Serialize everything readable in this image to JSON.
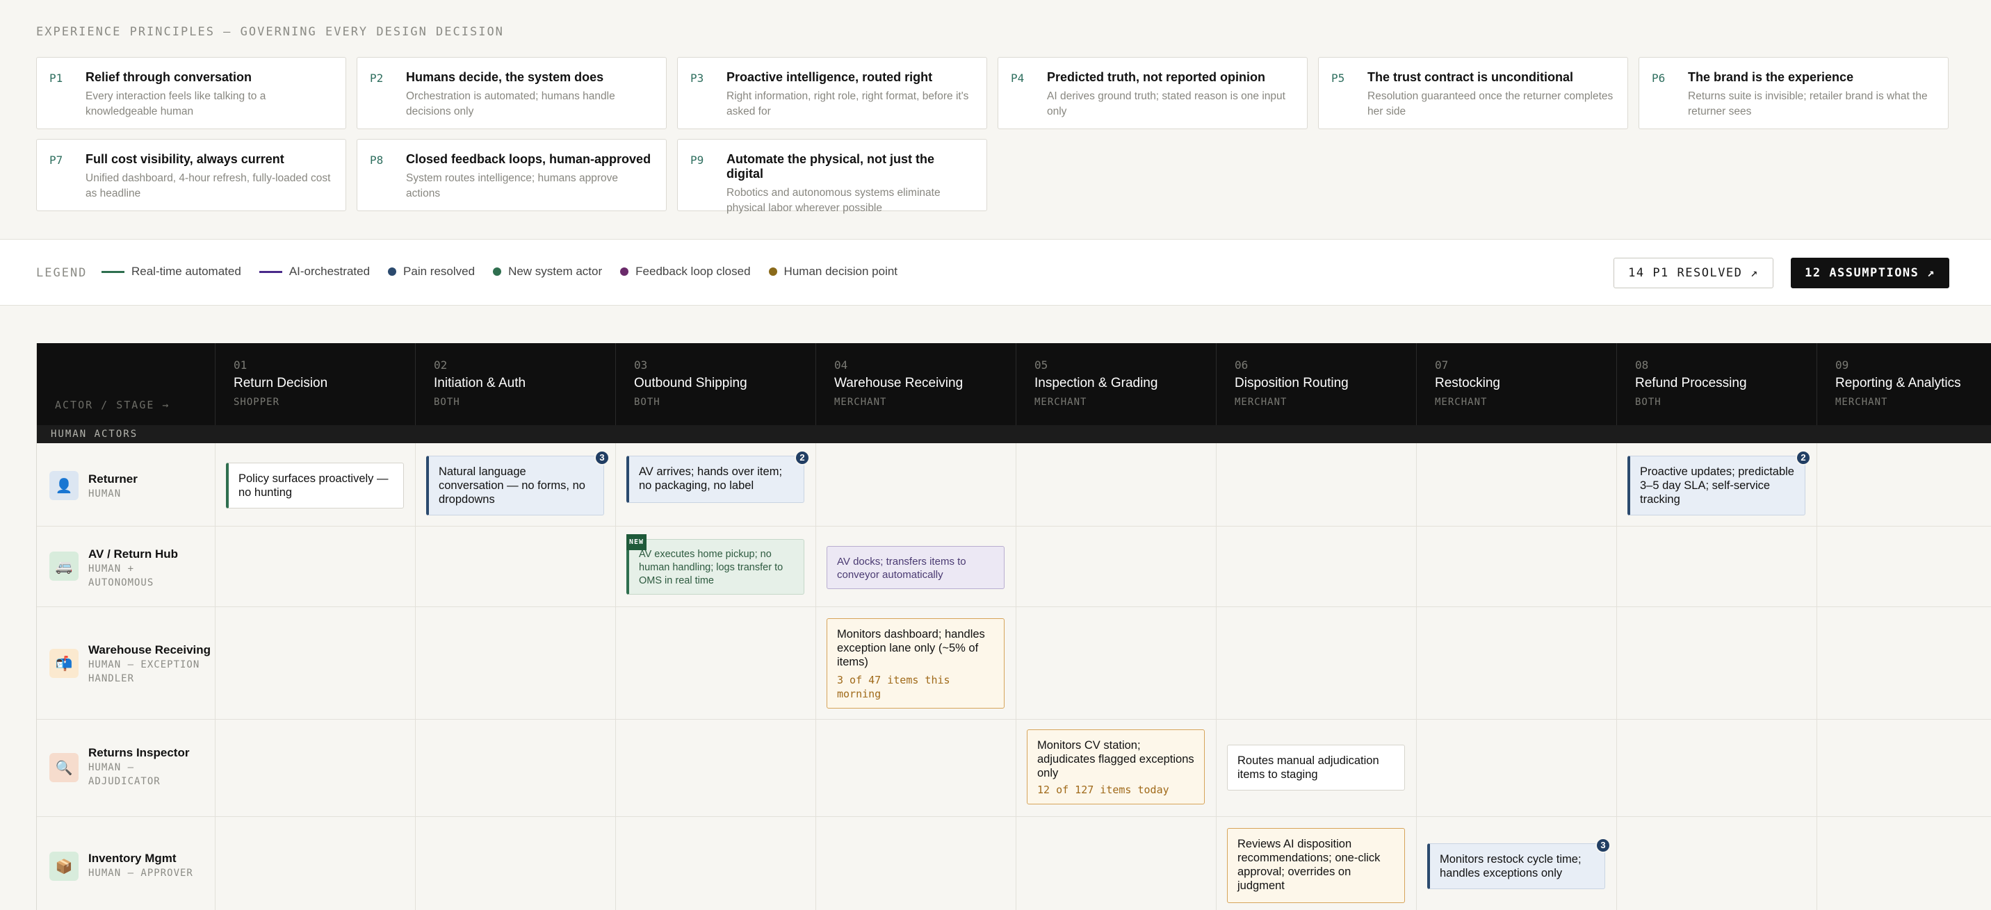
{
  "principles": {
    "title": "EXPERIENCE PRINCIPLES — GOVERNING EVERY DESIGN DECISION",
    "items": [
      {
        "id": "P1",
        "title": "Relief through conversation",
        "desc": "Every interaction feels like talking to a knowledgeable human"
      },
      {
        "id": "P2",
        "title": "Humans decide, the system does",
        "desc": "Orchestration is automated; humans handle decisions only"
      },
      {
        "id": "P3",
        "title": "Proactive intelligence, routed right",
        "desc": "Right information, right role, right format, before it's asked for"
      },
      {
        "id": "P4",
        "title": "Predicted truth, not reported opinion",
        "desc": "AI derives ground truth; stated reason is one input only"
      },
      {
        "id": "P5",
        "title": "The trust contract is unconditional",
        "desc": "Resolution guaranteed once the returner completes her side"
      },
      {
        "id": "P6",
        "title": "The brand is the experience",
        "desc": "Returns suite is invisible; retailer brand is what the returner sees"
      },
      {
        "id": "P7",
        "title": "Full cost visibility, always current",
        "desc": "Unified dashboard, 4-hour refresh, fully-loaded cost as headline"
      },
      {
        "id": "P8",
        "title": "Closed feedback loops, human-approved",
        "desc": "System routes intelligence; humans approve actions"
      },
      {
        "id": "P9",
        "title": "Automate the physical, not just the digital",
        "desc": "Robotics and autonomous systems eliminate physical labor wherever possible"
      }
    ]
  },
  "legend": {
    "title": "LEGEND",
    "items": [
      {
        "label": "Real-time automated",
        "kind": "line",
        "color": "#2f6f4f"
      },
      {
        "label": "AI-orchestrated",
        "kind": "line",
        "color": "#4a2a8a"
      },
      {
        "label": "Pain resolved",
        "kind": "dot",
        "color": "#2b4a6e"
      },
      {
        "label": "New system actor",
        "kind": "dot",
        "color": "#2f6f4f"
      },
      {
        "label": "Feedback loop closed",
        "kind": "dot",
        "color": "#6a2a6a"
      },
      {
        "label": "Human decision point",
        "kind": "dot",
        "color": "#8a6a1a"
      }
    ],
    "p1_button": "14 P1 RESOLVED ↗",
    "assumptions_button": "12 ASSUMPTIONS ↗"
  },
  "grid": {
    "corner_label": "ACTOR / STAGE →",
    "stages": [
      {
        "num": "01",
        "name": "Return Decision",
        "owner": "SHOPPER"
      },
      {
        "num": "02",
        "name": "Initiation & Auth",
        "owner": "BOTH"
      },
      {
        "num": "03",
        "name": "Outbound Shipping",
        "owner": "BOTH"
      },
      {
        "num": "04",
        "name": "Warehouse Receiving",
        "owner": "MERCHANT"
      },
      {
        "num": "05",
        "name": "Inspection & Grading",
        "owner": "MERCHANT"
      },
      {
        "num": "06",
        "name": "Disposition Routing",
        "owner": "MERCHANT"
      },
      {
        "num": "07",
        "name": "Restocking",
        "owner": "MERCHANT"
      },
      {
        "num": "08",
        "name": "Refund Processing",
        "owner": "BOTH"
      },
      {
        "num": "09",
        "name": "Reporting & Analytics",
        "owner": "MERCHANT"
      }
    ],
    "group_label": "HUMAN ACTORS",
    "actors": [
      {
        "name": "Returner",
        "role": "HUMAN",
        "icon": "person-icon"
      },
      {
        "name": "AV / Return Hub",
        "role": "HUMAN + AUTONOMOUS",
        "icon": "vehicle-icon"
      },
      {
        "name": "Warehouse Receiving",
        "role": "HUMAN — EXCEPTION HANDLER",
        "icon": "mailbox-icon"
      },
      {
        "name": "Returns Inspector",
        "role": "HUMAN — ADJUDICATOR",
        "icon": "magnifier-icon"
      },
      {
        "name": "Inventory Mgmt",
        "role": "HUMAN — APPROVER",
        "icon": "package-icon"
      }
    ],
    "cards": {
      "returner_s1": "Policy surfaces proactively — no hunting",
      "returner_s2": "Natural language conversation — no forms, no dropdowns",
      "returner_s2_badge": "3",
      "returner_s3": "AV arrives; hands over item; no packaging, no label",
      "returner_s3_badge": "2",
      "returner_s8": "Proactive updates; predictable 3–5 day SLA; self-service tracking",
      "returner_s8_badge": "2",
      "av_s3_tag": "NEW",
      "av_s3": "AV executes home pickup; no human handling; logs transfer to OMS in real time",
      "av_s4": "AV docks; transfers items to conveyor automatically",
      "wh_s4": "Monitors dashboard; handles exception lane only (~5% of items)",
      "wh_s4_sub": "3 of 47 items this morning",
      "insp_s5": "Monitors CV station; adjudicates flagged exceptions only",
      "insp_s5_sub": "12 of 127 items today",
      "insp_s6": "Routes manual adjudication items to staging",
      "inv_s6": "Reviews AI disposition recommendations; one-click approval; overrides on judgment",
      "inv_s7": "Monitors restock cycle time; handles exceptions only",
      "inv_s7_badge": "3"
    }
  }
}
